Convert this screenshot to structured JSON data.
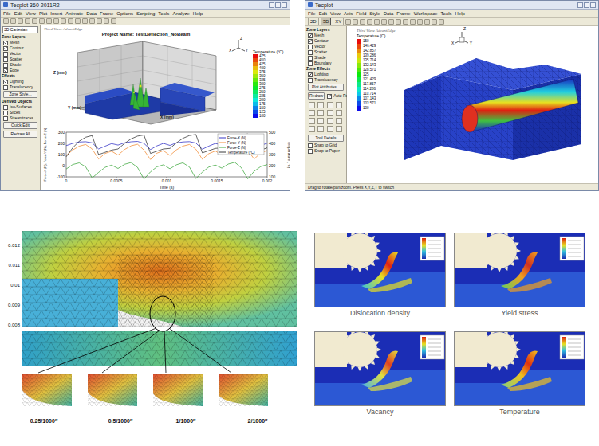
{
  "left_window": {
    "title": "Tecplot 360 2011R2",
    "menu": [
      "File",
      "Edit",
      "View",
      "Plot",
      "Insert",
      "Animate",
      "Data",
      "Frame",
      "Options",
      "Scripting",
      "Tools",
      "Analyze",
      "Help"
    ],
    "sidebar": {
      "mode": "3D Cartesian",
      "layers_heading": "Zone Layers",
      "layers": [
        {
          "label": "Mesh",
          "checked": true
        },
        {
          "label": "Contour",
          "checked": true
        },
        {
          "label": "Vector",
          "checked": false
        },
        {
          "label": "Scatter",
          "checked": false
        },
        {
          "label": "Shade",
          "checked": false
        },
        {
          "label": "Edge",
          "checked": true
        }
      ],
      "effects_heading": "Effects",
      "effects": [
        {
          "label": "Lighting",
          "checked": true
        },
        {
          "label": "Translucency",
          "checked": false
        }
      ],
      "zone_button": "Zone Style...",
      "derived_heading": "Derived Objects",
      "derived": [
        {
          "label": "Iso-Surfaces",
          "checked": false
        },
        {
          "label": "Slices",
          "checked": false
        },
        {
          "label": "Streamtraces",
          "checked": false
        }
      ],
      "quick_button": "Quick Edit",
      "redraw_button": "Redraw All"
    },
    "plot": {
      "brand": "Third Wave AdvantEdge",
      "project": "Project Name: TestDeflection_NoBeam",
      "axes": [
        "X (mm)",
        "Y (mm)",
        "Z (mm)"
      ],
      "triad": [
        "X",
        "Y",
        "Z"
      ],
      "legend_title": "Temperature (°C)",
      "legend_values": [
        "475",
        "450",
        "425",
        "400",
        "375",
        "350",
        "325",
        "300",
        "275",
        "250",
        "225",
        "200",
        "175",
        "150",
        "125",
        "100"
      ]
    },
    "chart": {
      "x_label": "Time (s)",
      "y_label": "Force-X (N), Force-Y (N), Force-Z (N)",
      "y2_label": "Temperature (°C)",
      "x_ticks": [
        "0",
        "0.0005",
        "0.001",
        "0.0015",
        "0.002"
      ],
      "y_ticks": [
        "300",
        "200",
        "100",
        "0",
        "-100"
      ],
      "y2_ticks": [
        "500",
        "400",
        "300",
        "200",
        "100"
      ],
      "series": [
        {
          "label": "Force-X (N)",
          "color": "#2020c0",
          "axis": "left",
          "values": [
            180,
            200,
            212,
            215,
            205,
            150,
            175,
            198,
            185,
            205,
            214,
            218,
            200,
            145,
            178,
            200,
            182,
            204,
            213,
            216,
            203,
            148,
            176,
            199,
            186,
            206,
            215,
            219,
            198,
            150,
            180,
            202
          ]
        },
        {
          "label": "Force-Y (N)",
          "color": "#f08020",
          "axis": "left",
          "values": [
            90,
            140,
            175,
            190,
            150,
            60,
            110,
            130,
            95,
            145,
            178,
            192,
            140,
            55,
            112,
            135,
            92,
            142,
            176,
            190,
            148,
            58,
            108,
            132,
            96,
            146,
            180,
            195,
            138,
            60,
            115,
            136
          ]
        },
        {
          "label": "Force-Z (N)",
          "color": "#2ea02e",
          "axis": "left",
          "values": [
            -30,
            10,
            25,
            -10,
            -110,
            -60,
            -15,
            5,
            -25,
            12,
            28,
            -15,
            -120,
            -55,
            -10,
            8,
            -28,
            8,
            26,
            -12,
            -115,
            -58,
            -12,
            6,
            -22,
            14,
            30,
            -18,
            -118,
            -50,
            -8,
            10
          ]
        },
        {
          "label": "Temperature (°C)",
          "color": "#222222",
          "axis": "right",
          "values": [
            280,
            360,
            420,
            455,
            470,
            300,
            320,
            340,
            350,
            400,
            440,
            465,
            475,
            310,
            330,
            350,
            355,
            405,
            445,
            470,
            480,
            315,
            335,
            355,
            360,
            410,
            450,
            472,
            485,
            320,
            340,
            360
          ]
        }
      ]
    }
  },
  "right_window": {
    "title": "Tecplot",
    "menu": [
      "File",
      "Edit",
      "View",
      "Axis",
      "Field",
      "Style",
      "Data",
      "Frame",
      "Workspace",
      "Tools",
      "Help"
    ],
    "modes": [
      {
        "label": "2D",
        "selected": false
      },
      {
        "label": "3D",
        "selected": true
      },
      {
        "label": "XY",
        "selected": false
      }
    ],
    "sidebar": {
      "layers_heading": "Zone Layers",
      "layers": [
        {
          "label": "Mesh",
          "checked": true
        },
        {
          "label": "Contour",
          "checked": true
        },
        {
          "label": "Vector",
          "checked": false
        },
        {
          "label": "Scatter",
          "checked": false
        },
        {
          "label": "Shade",
          "checked": false
        },
        {
          "label": "Boundary",
          "checked": false
        }
      ],
      "effects_heading": "Zone Effects",
      "effects": [
        {
          "label": "Lighting",
          "checked": true
        },
        {
          "label": "Translucency",
          "checked": false
        }
      ],
      "attributes_button": "Plot Attributes...",
      "redraw_button": "Redraw",
      "auto_redraw": {
        "label": "Auto Redraw",
        "checked": true
      },
      "tool_button": "Tool Details",
      "snaps": [
        {
          "label": "Snap to Grid",
          "checked": false
        },
        {
          "label": "Snap to Paper",
          "checked": false
        }
      ]
    },
    "plot": {
      "brand": "Third Wave AdvantEdge",
      "triad": [
        "X",
        "Y",
        "Z"
      ],
      "legend_title": "Temperature (C)",
      "legend_values": [
        "150",
        "146.429",
        "142.857",
        "139.286",
        "135.714",
        "132.143",
        "128.571",
        "125",
        "121.429",
        "117.857",
        "114.286",
        "110.714",
        "107.143",
        "103.571",
        "100"
      ]
    },
    "status": "Drag to rotate/pan/zoom. Press X,Y,Z,T to switch"
  },
  "mesh_figure": {
    "y_ticks": [
      "0.012",
      "0.011",
      "0.01",
      "0.009",
      "0.008"
    ],
    "labels": [
      "0.25/1000″",
      "0.5/1000″",
      "1/1000″",
      "2/1000″"
    ]
  },
  "fields_figure": {
    "panels": [
      {
        "caption": "Dislocation density"
      },
      {
        "caption": "Yield stress"
      },
      {
        "caption": "Vacancy"
      },
      {
        "caption": "Temperature"
      }
    ]
  }
}
